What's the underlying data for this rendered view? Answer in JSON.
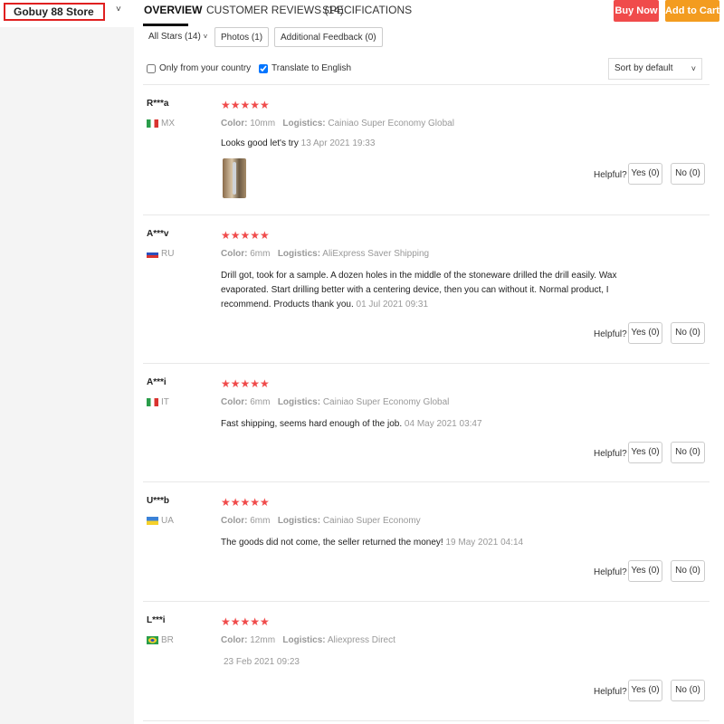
{
  "header": {
    "store_name": "Gobuy 88 Store",
    "tabs": [
      "OVERVIEW",
      "CUSTOMER REVIEWS (14)",
      "SPECIFICATIONS"
    ],
    "buy_now": "Buy Now",
    "add_to_cart": "Add to Cart"
  },
  "filters": {
    "all_stars": "All Stars (14)",
    "photos": "Photos (1)",
    "additional_feedback": "Additional Feedback (0)",
    "only_country": "Only from your country",
    "translate": "Translate to English",
    "sort": "Sort by default"
  },
  "labels": {
    "color": "Color:",
    "logistics": "Logistics:",
    "helpful": "Helpful?"
  },
  "reviews": [
    {
      "user": "R***a",
      "country": "MX",
      "stars": "★★★★★",
      "color": "10mm",
      "logistics": "Cainiao Super Economy Global",
      "text": "Looks good let's try",
      "date": "13 Apr 2021 19:33",
      "yes": "Yes (0)",
      "no": "No (0)"
    },
    {
      "user": "A***v",
      "country": "RU",
      "stars": "★★★★★",
      "color": "6mm",
      "logistics": "AliExpress Saver Shipping",
      "text": "Drill got, took for a sample. A dozen holes in the middle of the stoneware drilled the drill easily. Wax evaporated. Start drilling better with a centering device, then you can without it. Normal product, I recommend. Products thank you.",
      "date": "01 Jul 2021 09:31",
      "yes": "Yes (0)",
      "no": "No (0)"
    },
    {
      "user": "A***i",
      "country": "IT",
      "stars": "★★★★★",
      "color": "6mm",
      "logistics": "Cainiao Super Economy Global",
      "text": "Fast shipping, seems hard enough of the job.",
      "date": "04 May 2021 03:47",
      "yes": "Yes (0)",
      "no": "No (0)"
    },
    {
      "user": "U***b",
      "country": "UA",
      "stars": "★★★★★",
      "color": "6mm",
      "logistics": "Cainiao Super Economy",
      "text": "The goods did not come, the seller returned the money!",
      "date": "19 May 2021 04:14",
      "yes": "Yes (0)",
      "no": "No (0)"
    },
    {
      "user": "L***i",
      "country": "BR",
      "stars": "★★★★★",
      "color": "12mm",
      "logistics": "Aliexpress Direct",
      "text": "",
      "date": "23 Feb 2021 09:23",
      "yes": "Yes (0)",
      "no": "No (0)"
    }
  ]
}
